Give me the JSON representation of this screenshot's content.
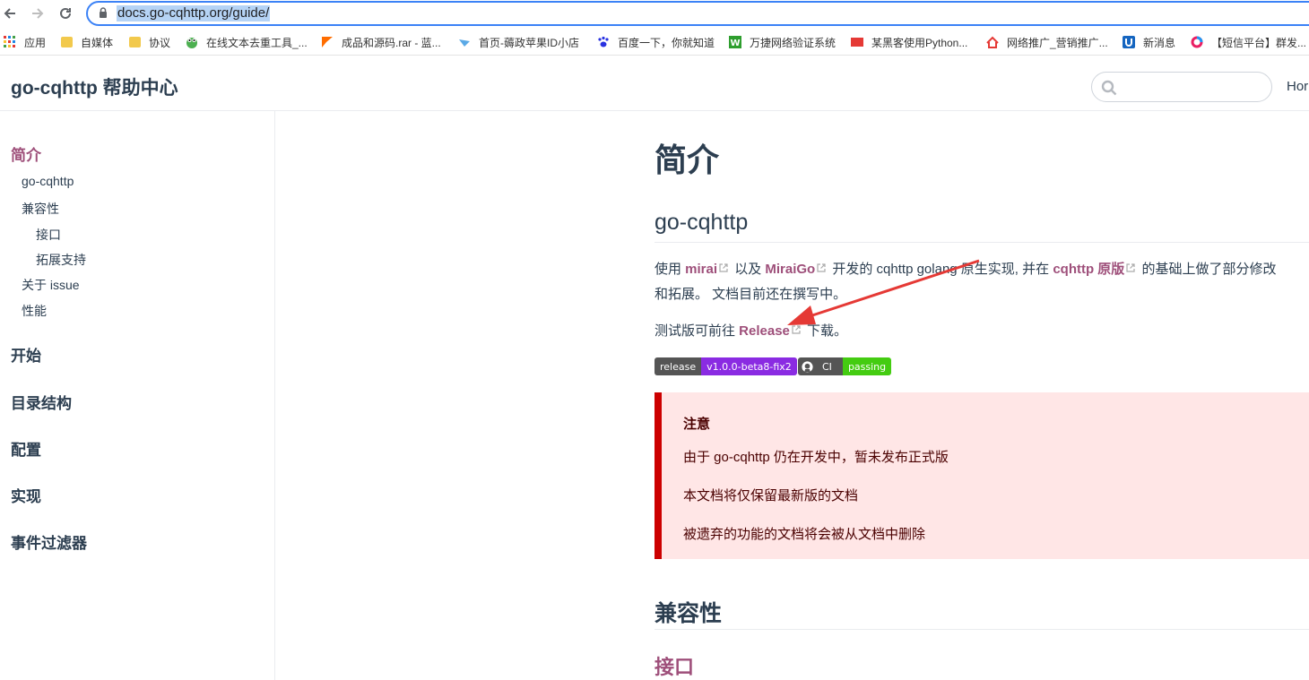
{
  "browser": {
    "url": "docs.go-cqhttp.org/guide/",
    "bookmarks": [
      {
        "label": "应用",
        "icon": "apps-grid-icon"
      },
      {
        "label": "自媒体",
        "icon": "folder-icon"
      },
      {
        "label": "协议",
        "icon": "folder-icon"
      },
      {
        "label": "在线文本去重工具_...",
        "icon": "frog-icon"
      },
      {
        "label": "成品和源码.rar - 蓝...",
        "icon": "orange-flag-icon"
      },
      {
        "label": "首页-薅政苹果ID小店",
        "icon": "bird-icon"
      },
      {
        "label": "百度一下，你就知道",
        "icon": "baidu-paw-icon"
      },
      {
        "label": "万捷网络验证系统",
        "icon": "w-logo-icon"
      },
      {
        "label": "某黑客使用Python...",
        "icon": "red-badge-icon"
      },
      {
        "label": "网络推广_营销推广...",
        "icon": "house-logo-icon"
      },
      {
        "label": "新消息",
        "icon": "u-logo-icon"
      },
      {
        "label": "【短信平台】群发...",
        "icon": "ring-logo-icon"
      }
    ]
  },
  "site": {
    "title": "go-cqhttp 帮助中心",
    "nav_home": "Hor",
    "search_placeholder": ""
  },
  "sidebar": {
    "groups": [
      {
        "label": "简介",
        "active": true,
        "items": [
          {
            "label": "go-cqhttp",
            "level": 1
          },
          {
            "label": "兼容性",
            "level": 1
          },
          {
            "label": "接口",
            "level": 2
          },
          {
            "label": "拓展支持",
            "level": 2
          },
          {
            "label": "关于 issue",
            "level": 1
          },
          {
            "label": "性能",
            "level": 1
          }
        ]
      },
      {
        "label": "开始"
      },
      {
        "label": "目录结构"
      },
      {
        "label": "配置"
      },
      {
        "label": "实现"
      },
      {
        "label": "事件过滤器"
      }
    ]
  },
  "content": {
    "h1": "简介",
    "h2": "go-cqhttp",
    "intro": {
      "t1": "使用 ",
      "link1": "mirai",
      "t2": " 以及 ",
      "link2": "MiraiGo",
      "t3": " 开发的 cqhttp golang 原生实现, 并在 ",
      "link3": "cqhttp 原版",
      "t4": " 的基础上做了部分修改",
      "line2": "和拓展。 文档目前还在撰写中。"
    },
    "release_line": {
      "t1": "测试版可前往 ",
      "link": "Release",
      "t2": " 下载。"
    },
    "badges": {
      "release_label": "release",
      "release_value": "v1.0.0-beta8-fix2",
      "ci_label": "CI",
      "ci_value": "passing"
    },
    "warning": {
      "title": "注意",
      "lines": [
        "由于 go-cqhttp 仍在开发中，暂未发布正式版",
        "本文档将仅保留最新版的文档",
        "被遗弃的功能的文档将会被从文档中删除"
      ]
    },
    "h2b": "兼容性",
    "h3": "接口"
  },
  "colors": {
    "accent": "#9e4f7a",
    "warning_border": "#cc0000",
    "warning_bg": "#ffe6e6",
    "annotation_arrow": "#e53935"
  }
}
